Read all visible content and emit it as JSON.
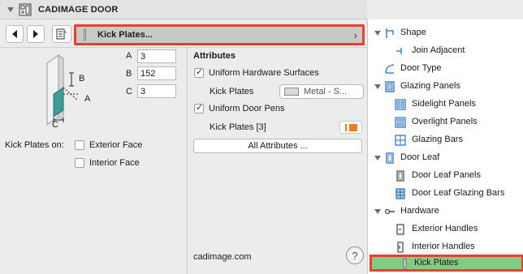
{
  "header": {
    "title": "CADIMAGE DOOR"
  },
  "page_selector": {
    "label": "Kick Plates...",
    "chevron": "›"
  },
  "dimensions": {
    "a_label": "A",
    "a_value": "3",
    "b_label": "B",
    "b_value": "152",
    "c_label": "C",
    "c_value": "3"
  },
  "diagram": {
    "label_a": "A",
    "label_b": "B",
    "label_c": "C"
  },
  "kick_plates_on": {
    "label": "Kick Plates on:",
    "exterior_label": "Exterior Face",
    "interior_label": "Interior Face"
  },
  "attributes": {
    "heading": "Attributes",
    "uniform_surfaces_label": "Uniform Hardware Surfaces",
    "kick_plates_label": "Kick Plates",
    "material_value": "Metal - S...",
    "uniform_pens_label": "Uniform Door Pens",
    "kick_plates_pen_label": "Kick Plates [3]",
    "all_attributes_label": "All Attributes ..."
  },
  "footer": {
    "site": "cadimage.com",
    "help_glyph": "?"
  },
  "tree": {
    "items": [
      {
        "label": "Shape"
      },
      {
        "label": "Join Adjacent"
      },
      {
        "label": "Door Type"
      },
      {
        "label": "Glazing Panels"
      },
      {
        "label": "Sidelight Panels"
      },
      {
        "label": "Overlight Panels"
      },
      {
        "label": "Glazing Bars"
      },
      {
        "label": "Door Leaf"
      },
      {
        "label": "Door Leaf Panels"
      },
      {
        "label": "Door Leaf Glazing Bars"
      },
      {
        "label": "Hardware"
      },
      {
        "label": "Exterior Handles"
      },
      {
        "label": "Interior Handles"
      },
      {
        "label": "Kick Plates"
      }
    ]
  },
  "colors": {
    "highlight_border": "#e5412f",
    "selected_bg": "#7fcd82",
    "pen_color": "#f07d1a",
    "plate_teal": "#3a9e9a"
  }
}
